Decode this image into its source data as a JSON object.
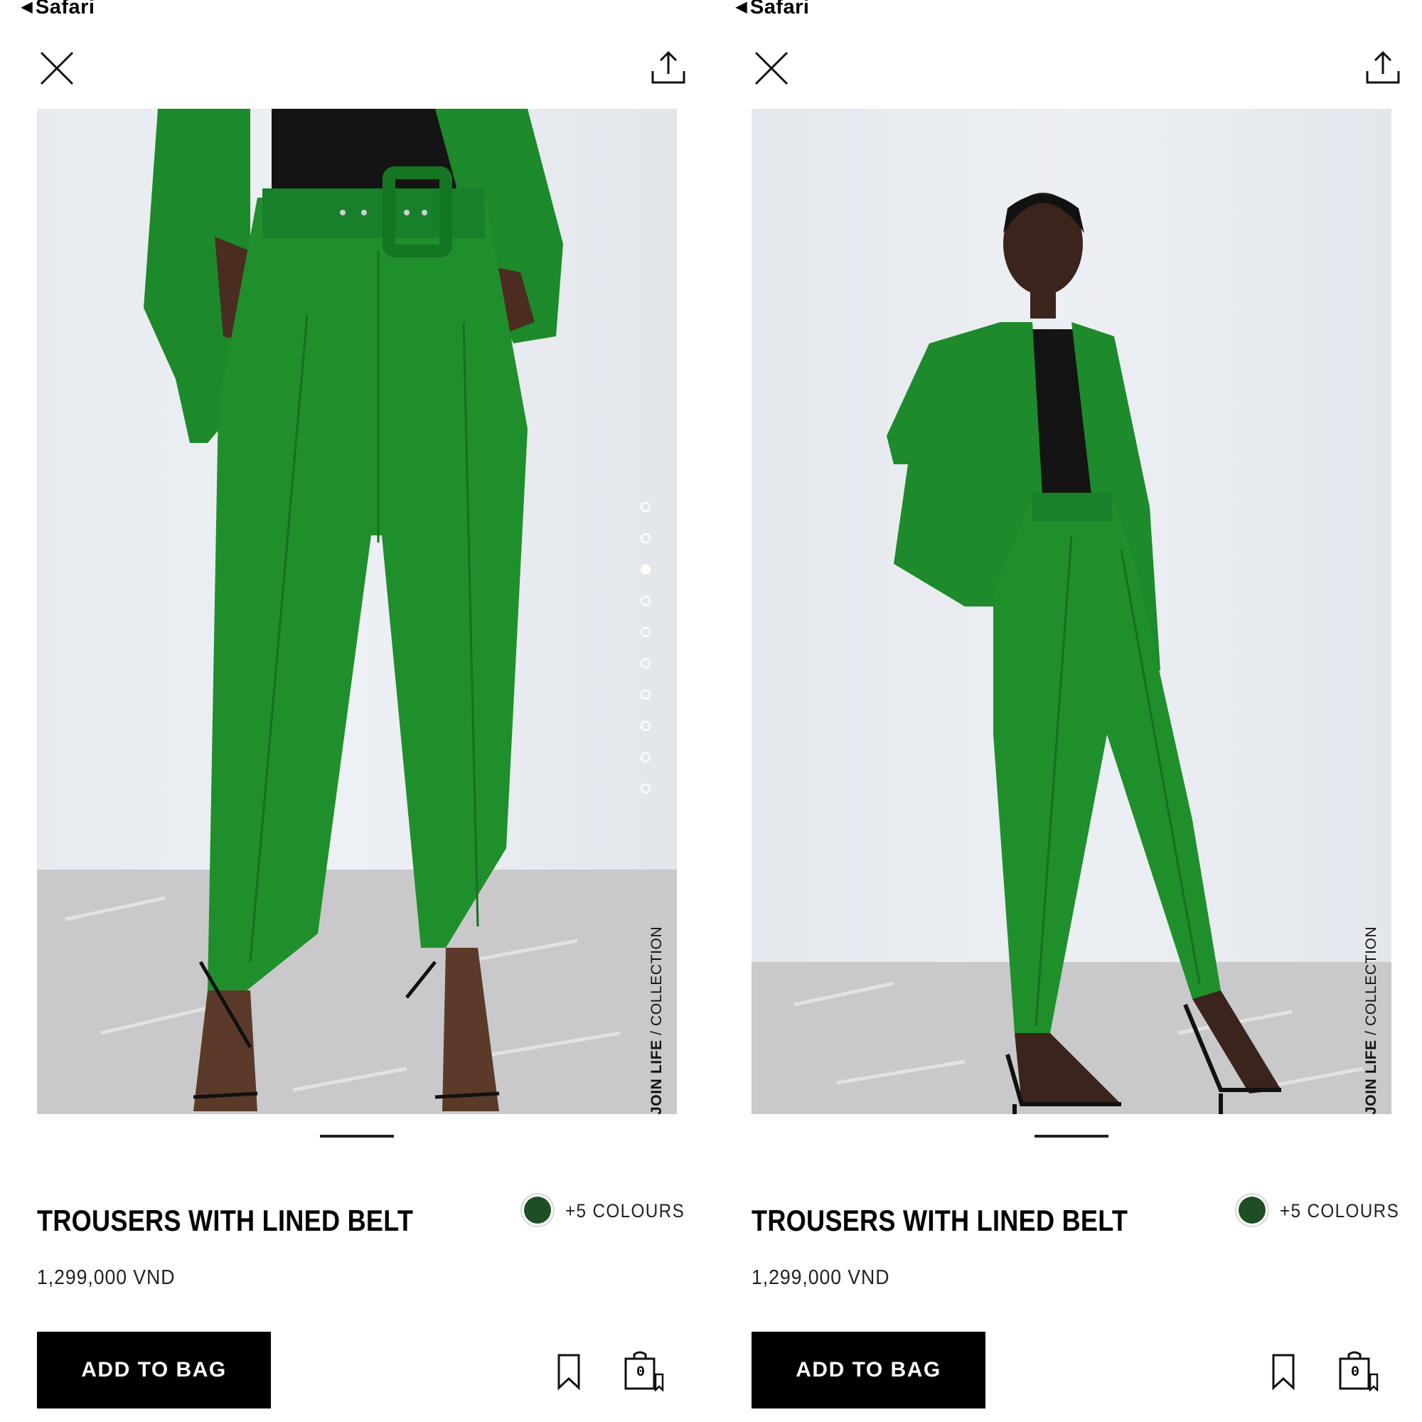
{
  "status_bar": {
    "back_app": "Safari"
  },
  "product": {
    "title": "TROUSERS WITH LINED BELT",
    "price": "1,299,000 VND",
    "colours_link": "+5 COLOURS",
    "swatch_color": "#1d4e24"
  },
  "gallery": {
    "collection_bold": "JOIN LIFE",
    "collection_rest": " / COLLECTION",
    "dot_count": 10,
    "active_dot": 3
  },
  "actions": {
    "add_to_bag_label": "ADD TO BAG",
    "bag_count": "0"
  },
  "icons": [
    "close-icon",
    "share-icon",
    "bookmark-icon",
    "shopping-bag-icon"
  ]
}
